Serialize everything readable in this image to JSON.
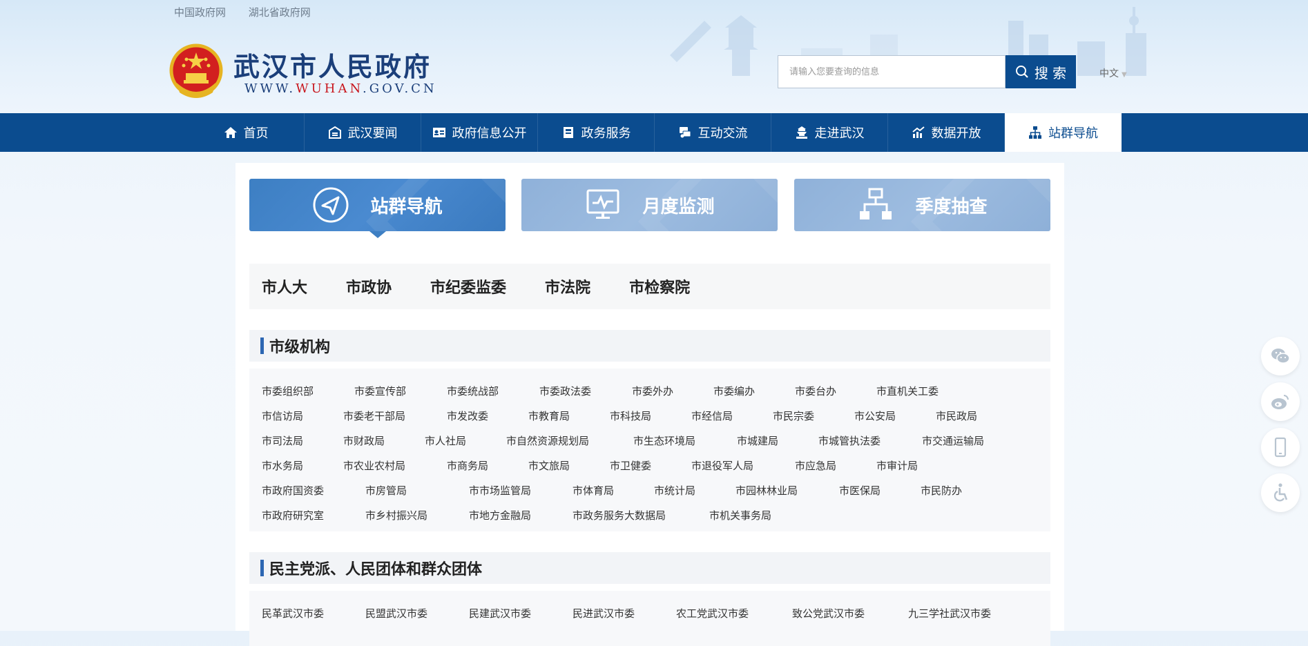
{
  "top_links": [
    "中国政府网",
    "湖北省政府网"
  ],
  "site": {
    "title": "武汉市人民政府",
    "url_prefix": "WWW.",
    "url_brand": "WUHAN",
    "url_suffix": ".GOV.CN"
  },
  "search": {
    "placeholder": "请输入您要查询的信息",
    "button_label": "搜 索"
  },
  "language": "中文",
  "nav": [
    {
      "label": "首页",
      "icon": "home-icon"
    },
    {
      "label": "武汉要闻",
      "icon": "news-icon"
    },
    {
      "label": "政府信息公开",
      "icon": "info-card-icon"
    },
    {
      "label": "政务服务",
      "icon": "service-icon"
    },
    {
      "label": "互动交流",
      "icon": "interaction-icon"
    },
    {
      "label": "走进武汉",
      "icon": "city-icon"
    },
    {
      "label": "数据开放",
      "icon": "chart-icon"
    },
    {
      "label": "站群导航",
      "icon": "sitemap-icon",
      "active": true
    }
  ],
  "big_tabs": [
    {
      "label": "站群导航",
      "icon": "send-icon",
      "active": true
    },
    {
      "label": "月度监测",
      "icon": "monitor-icon"
    },
    {
      "label": "季度抽查",
      "icon": "hierarchy-icon"
    }
  ],
  "top_orgs": [
    "市人大",
    "市政协",
    "市纪委监委",
    "市法院",
    "市检察院"
  ],
  "section_city": {
    "title": "市级机构",
    "rows": [
      [
        "市委组织部",
        "市委宣传部",
        "市委统战部",
        "市委政法委",
        "市委外办",
        "市委编办",
        "市委台办",
        "市直机关工委"
      ],
      [
        "市信访局",
        "市委老干部局",
        "市发改委",
        "市教育局",
        "市科技局",
        "市经信局",
        "市民宗委",
        "市公安局",
        "市民政局"
      ],
      [
        "市司法局",
        "市财政局",
        "市人社局",
        "市自然资源规划局",
        "市生态环境局",
        "市城建局",
        "市城管执法委",
        "市交通运输局"
      ],
      [
        "市水务局",
        "市农业农村局",
        "市商务局",
        "市文旅局",
        "市卫健委",
        "市退役军人局",
        "市应急局",
        "市审计局"
      ],
      [
        "市政府国资委",
        "市房管局",
        "市市场监管局",
        "市体育局",
        "市统计局",
        "市园林林业局",
        "市医保局",
        "市民防办"
      ],
      [
        "市政府研究室",
        "市乡村振兴局",
        "市地方金融局",
        "市政务服务大数据局",
        "市机关事务局"
      ]
    ]
  },
  "section_parties": {
    "title": "民主党派、人民团体和群众团体",
    "rows": [
      [
        "民革武汉市委",
        "民盟武汉市委",
        "民建武汉市委",
        "民进武汉市委",
        "农工党武汉市委",
        "致公党武汉市委",
        "九三学社武汉市委"
      ]
    ]
  },
  "side_buttons": [
    "wechat-icon",
    "weibo-icon",
    "mobile-icon",
    "accessibility-icon"
  ],
  "colors": {
    "nav_bg": "#0b4c8f",
    "accent_blue": "#3d7fc3",
    "tab_dim": "#8fb1d9",
    "brand_red": "#c8161d"
  }
}
